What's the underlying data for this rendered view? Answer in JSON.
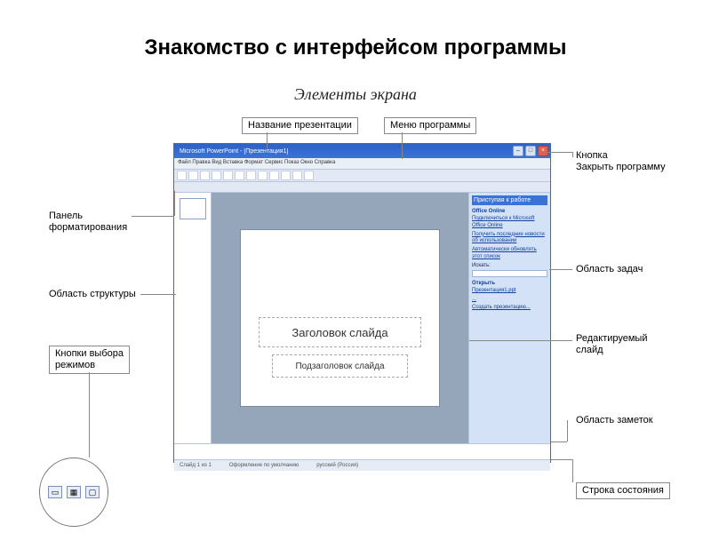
{
  "page": {
    "title": "Знакомство с интерфейсом программы",
    "subtitle": "Элементы экрана"
  },
  "labels": {
    "presentation_name": "Название презентации",
    "program_menu": "Меню программы",
    "close_button": "Кнопка\nЗакрыть программу",
    "formatting_panel": "Панель\nформатирования",
    "structure_area": "Область  структуры",
    "view_buttons": "Кнопки выбора\nрежимов",
    "task_pane": "Область задач",
    "editable_slide": "Редактируемый\nслайд",
    "notes_area": "Область заметок",
    "status_bar": "Строка состояния"
  },
  "app": {
    "titlebar": "Microsoft PowerPoint - [Презентация1]",
    "menu": "Файл  Правка  Вид  Вставка  Формат  Сервис  Показ  Окно  Справка",
    "slide_title_placeholder": "Заголовок слайда",
    "slide_subtitle_placeholder": "Подзаголовок слайда",
    "taskpane": {
      "header": "Приступая к работе",
      "office_online": "Office Online",
      "link1": "Подключиться к Microsoft Office Online",
      "link2": "Получить последние новости об использовании",
      "link3": "Автоматически обновлять этот список",
      "search_label": "Искать:",
      "open_label": "Открыть",
      "recent1": "Презентация1.ppt",
      "recent2": "...",
      "new_link": "Создать презентацию..."
    },
    "status": {
      "slide_info": "Слайд 1 из 1",
      "template": "Оформление по умолчанию",
      "lang": "русский (Россия)"
    }
  }
}
